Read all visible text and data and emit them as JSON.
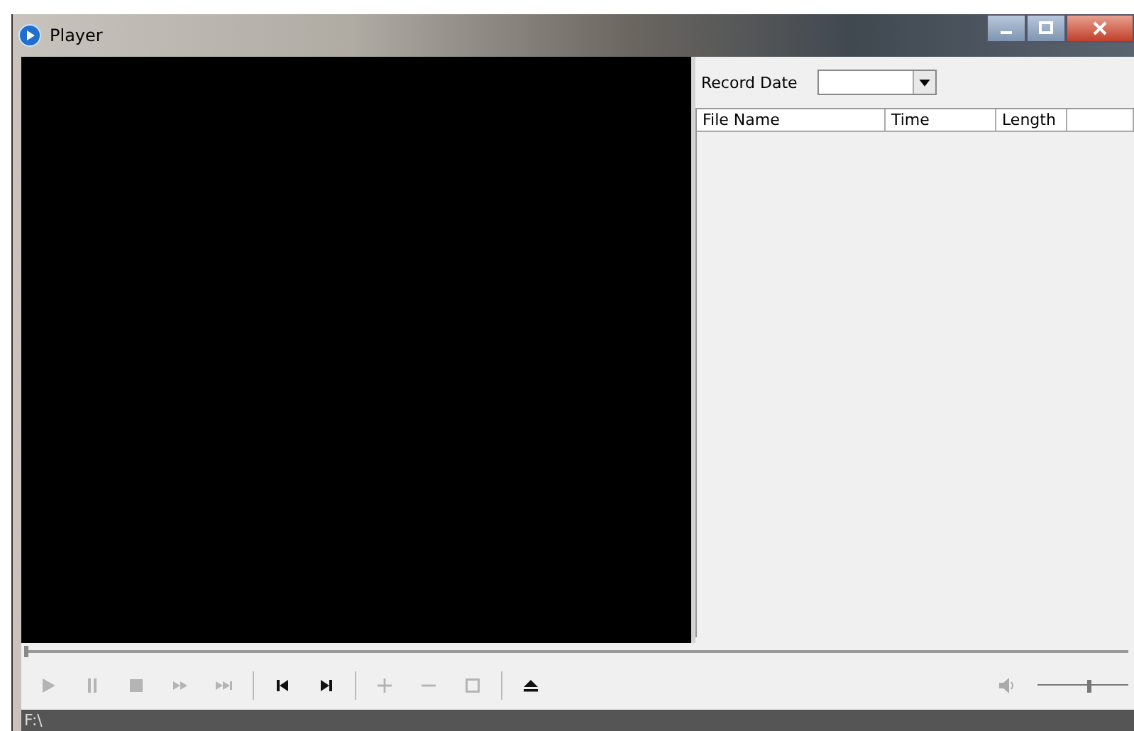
{
  "window": {
    "title": "Player"
  },
  "record_date": {
    "label": "Record Date"
  },
  "file_list": {
    "columns": [
      "File Name",
      "Time",
      "Length"
    ]
  },
  "seek": {
    "level": 0
  },
  "controls": [
    {
      "kind": "play",
      "disabled": true
    },
    {
      "kind": "pause",
      "disabled": true
    },
    {
      "kind": "stop",
      "disabled": true
    },
    {
      "kind": "fast",
      "disabled": true
    },
    {
      "kind": "next-frame",
      "disabled": true
    },
    {
      "kind": "sep"
    },
    {
      "kind": "prev-file",
      "disabled": false
    },
    {
      "kind": "next-file",
      "disabled": false
    },
    {
      "kind": "sep"
    },
    {
      "kind": "zoom-in",
      "disabled": true
    },
    {
      "kind": "zoom-out",
      "disabled": true
    },
    {
      "kind": "fullscreen",
      "disabled": true
    },
    {
      "kind": "sep"
    },
    {
      "kind": "eject",
      "disabled": false
    }
  ],
  "volume": {
    "level": 0.55
  },
  "status_bar": {
    "path": "F:\\"
  }
}
